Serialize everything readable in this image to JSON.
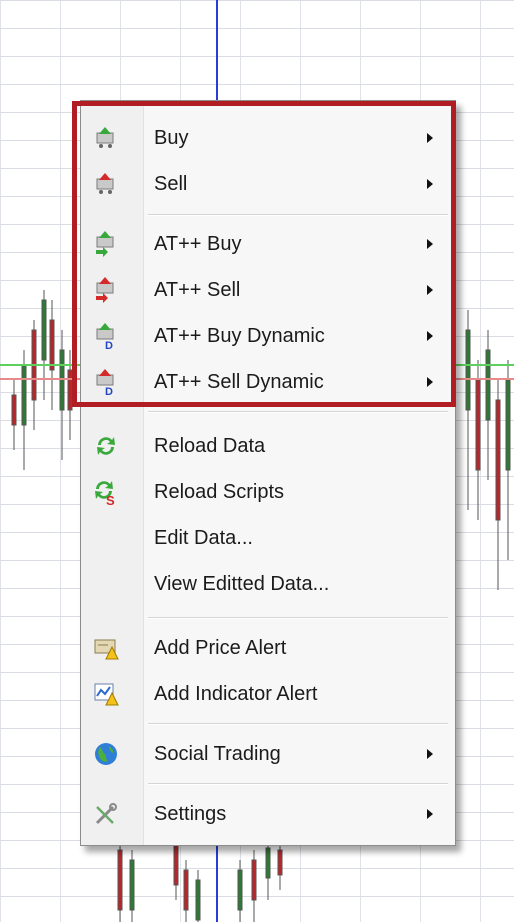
{
  "context_menu": {
    "items": [
      {
        "label": "Buy",
        "icon": "cart-buy-icon",
        "submenu": true
      },
      {
        "label": "Sell",
        "icon": "cart-sell-icon",
        "submenu": true
      },
      {
        "label": "AT++ Buy",
        "icon": "at-buy-icon",
        "submenu": true
      },
      {
        "label": "AT++ Sell",
        "icon": "at-sell-icon",
        "submenu": true
      },
      {
        "label": "AT++ Buy Dynamic",
        "icon": "at-buy-dynamic-icon",
        "submenu": true
      },
      {
        "label": "AT++ Sell Dynamic",
        "icon": "at-sell-dynamic-icon",
        "submenu": true
      },
      {
        "label": "Reload Data",
        "icon": "reload-icon",
        "submenu": false
      },
      {
        "label": "Reload Scripts",
        "icon": "reload-scripts-icon",
        "submenu": false
      },
      {
        "label": "Edit Data...",
        "icon": "",
        "submenu": false
      },
      {
        "label": "View Editted Data...",
        "icon": "",
        "submenu": false
      },
      {
        "label": "Add Price Alert",
        "icon": "price-alert-icon",
        "submenu": false
      },
      {
        "label": "Add Indicator Alert",
        "icon": "indicator-alert-icon",
        "submenu": false
      },
      {
        "label": "Social Trading",
        "icon": "globe-icon",
        "submenu": true
      },
      {
        "label": "Settings",
        "icon": "tools-icon",
        "submenu": true
      }
    ]
  },
  "colors": {
    "highlight": "#b01e24",
    "crosshair": "#2a3dd6"
  }
}
